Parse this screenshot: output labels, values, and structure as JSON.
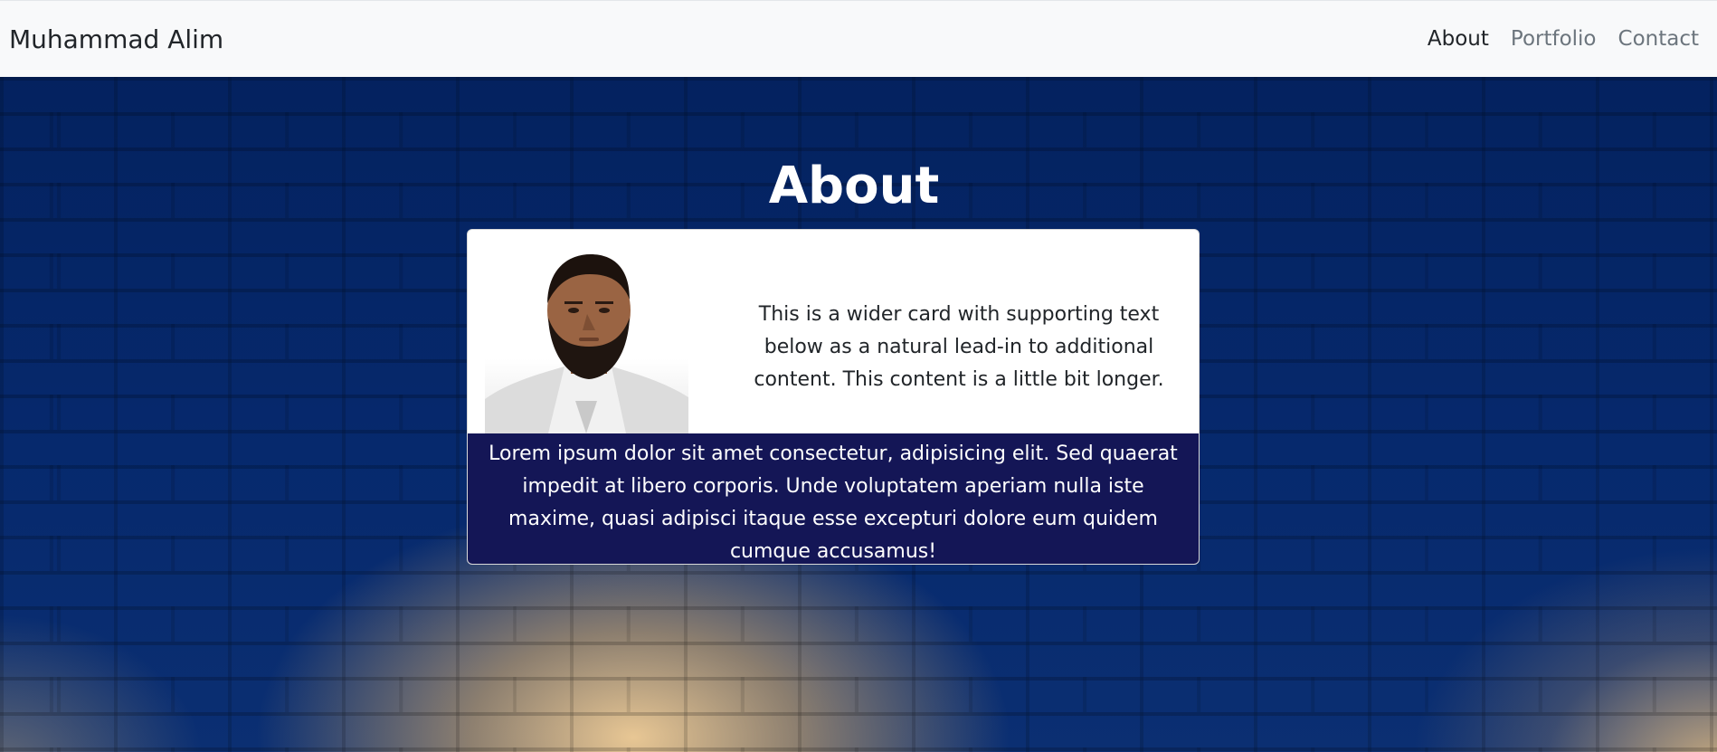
{
  "navbar": {
    "brand": "Muhammad Alim",
    "links": [
      {
        "label": "About",
        "active": true
      },
      {
        "label": "Portfolio",
        "active": false
      },
      {
        "label": "Contact",
        "active": false
      }
    ]
  },
  "hero": {
    "title": "About"
  },
  "card": {
    "image_alt": "profile photo",
    "text": "This is a wider card with supporting text below as a natural lead-in to additional content. This content is a little bit longer.",
    "footer_text": "Lorem ipsum dolor sit amet consectetur, adipisicing elit. Sed quaerat impedit at libero corporis. Unde voluptatem aperiam nulla iste maxime, quasi adipisci itaque esse excepturi dolore eum quidem cumque accusamus!"
  },
  "colors": {
    "navbar_bg": "#f8f9fa",
    "hero_blue": "#06296d",
    "card_footer_bg": "#141656",
    "text_dark": "#212529",
    "nav_muted": "#6c757d"
  }
}
